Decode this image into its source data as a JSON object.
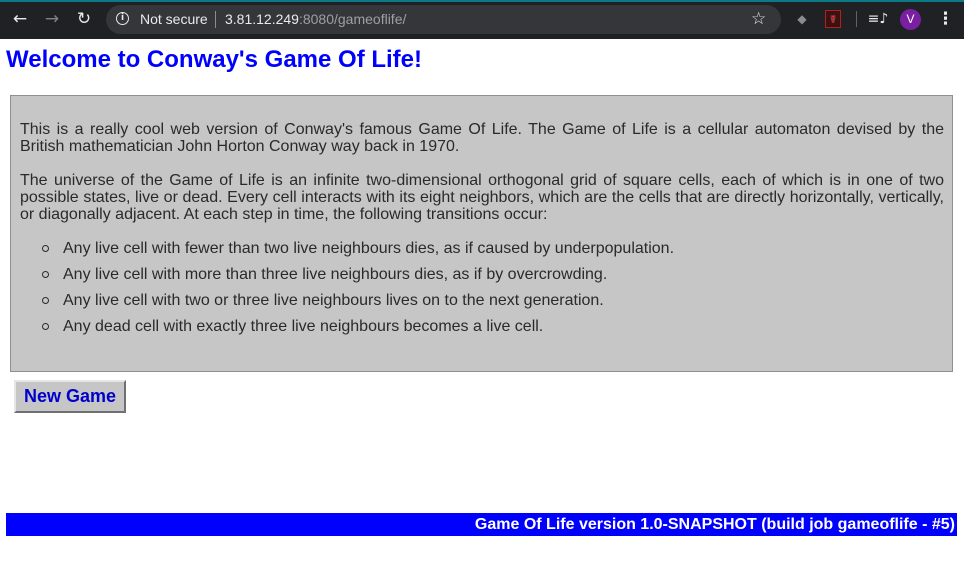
{
  "browser": {
    "security_label": "Not secure",
    "url_host": "3.81.12.249",
    "url_rest": ":8080/gameoflife/",
    "profile_initial": "V",
    "icons": {
      "back": "arrow-left-icon",
      "forward": "arrow-right-icon",
      "reload": "reload-icon",
      "info": "info-icon",
      "bookmark": "star-icon",
      "extension_1": "puzzle-icon",
      "extension_2": "pdf-icon",
      "media": "media-control-icon",
      "menu": "kebab-menu-icon"
    },
    "colors": {
      "toolbar": "#202124",
      "omnibox": "#35363a",
      "avatar": "#7b1fa2"
    }
  },
  "page": {
    "title": "Welcome to Conway's Game Of Life!",
    "intro": {
      "paragraph_1": "This is a really cool web version of Conway's famous Game Of Life. The Game of Life is a cellular automaton devised by the British mathematician John Horton Conway way back in 1970.",
      "paragraph_2": "The universe of the Game of Life is an infinite two-dimensional orthogonal grid of square cells, each of which is in one of two possible states, live or dead. Every cell interacts with its eight neighbors, which are the cells that are directly horizontally, vertically, or diagonally adjacent. At each step in time, the following transitions occur:",
      "rules": [
        "Any live cell with fewer than two live neighbours dies, as if caused by underpopulation.",
        "Any live cell with more than three live neighbours dies, as if by overcrowding.",
        "Any live cell with two or three live neighbours lives on to the next generation.",
        "Any dead cell with exactly three live neighbours becomes a live cell."
      ]
    },
    "new_game_label": "New Game",
    "footer_text": "Game Of Life version 1.0-SNAPSHOT (build job gameoflife - #5)",
    "colors": {
      "title": "#0000ff",
      "box_background": "#c6c6c6",
      "footer_background": "#0000ff",
      "footer_text": "#ffffff"
    }
  }
}
